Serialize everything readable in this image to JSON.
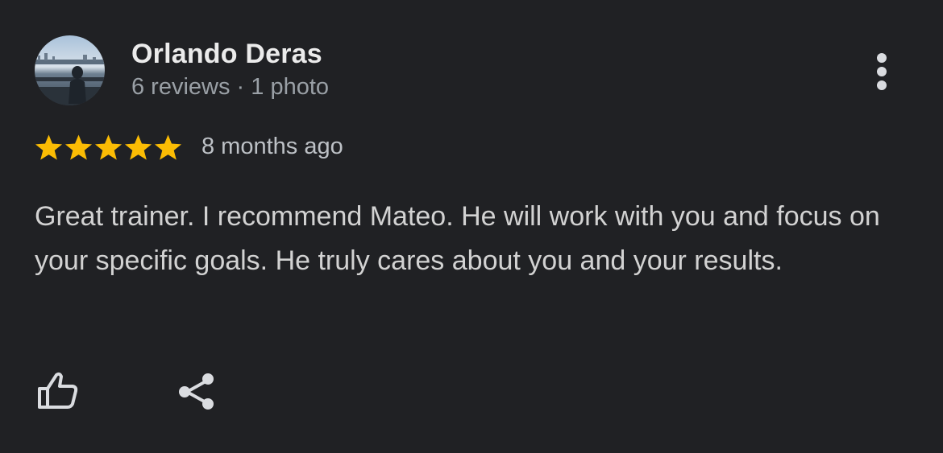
{
  "reviewer": {
    "name": "Orlando Deras",
    "meta": "6 reviews · 1 photo",
    "avatar": "profile photo"
  },
  "rating": {
    "stars": 5,
    "max_stars": 5,
    "star_color": "#fbbc04",
    "age": "8 months ago"
  },
  "review": {
    "text": "Great trainer. I recommend Mateo. He will work with you and focus on your specific goals. He truly cares about you and your results."
  },
  "actions": {
    "more_icon": "more-vert-icon",
    "like_icon": "thumbs-up-icon",
    "share_icon": "share-icon"
  },
  "colors": {
    "background": "#202124",
    "secondary_text": "#9aa0a6"
  }
}
